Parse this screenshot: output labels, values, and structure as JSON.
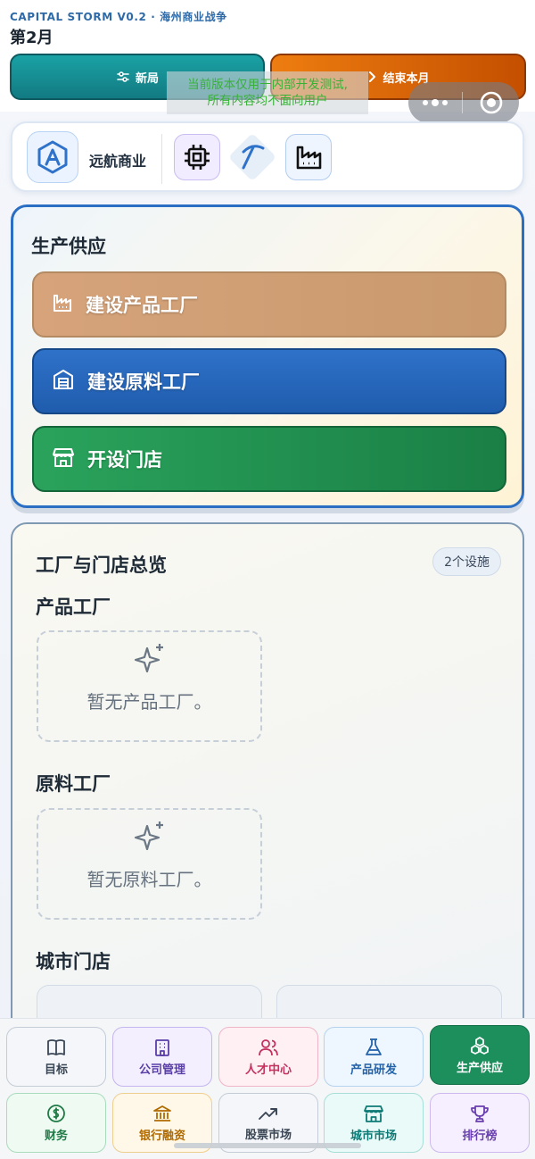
{
  "header": {
    "app_title": "CAPITAL STORM V0.2 · 海州商业战争",
    "month": "第2月",
    "new_game": "新局",
    "end_month": "结束本月",
    "dev_notice_line1": "当前版本仅用于内部开发测试,",
    "dev_notice_line2": "所有内容均不面向用户"
  },
  "company": {
    "name": "远航商业",
    "logo_icon": "hexagon-a-icon",
    "industries": [
      "chip-icon",
      "pickaxe-icon",
      "factory-icon"
    ]
  },
  "production": {
    "title": "生产供应",
    "build_product_factory": "建设产品工厂",
    "build_raw_factory": "建设原料工厂",
    "open_store": "开设门店"
  },
  "overview": {
    "title": "工厂与门店总览",
    "facility_count": "2个设施",
    "product_factory_title": "产品工厂",
    "product_factory_empty": "暂无产品工厂。",
    "raw_factory_title": "原料工厂",
    "raw_factory_empty": "暂无原料工厂。",
    "city_store_title": "城市门店"
  },
  "nav": {
    "goals": "目标",
    "company": "公司管理",
    "talent": "人才中心",
    "research": "产品研发",
    "production": "生产供应",
    "finance": "财务",
    "bank": "银行融资",
    "stock": "股票市场",
    "city_market": "城市市场",
    "leaderboard": "排行榜"
  },
  "colors": {
    "accent_blue": "#2b6fc4",
    "product_btn": "#d6a37a",
    "raw_btn": "#1f5cad",
    "store_btn": "#1a7f45",
    "end_month": "#e06a00",
    "new_game": "#15888e",
    "nav_active": "#1d8f5c"
  }
}
